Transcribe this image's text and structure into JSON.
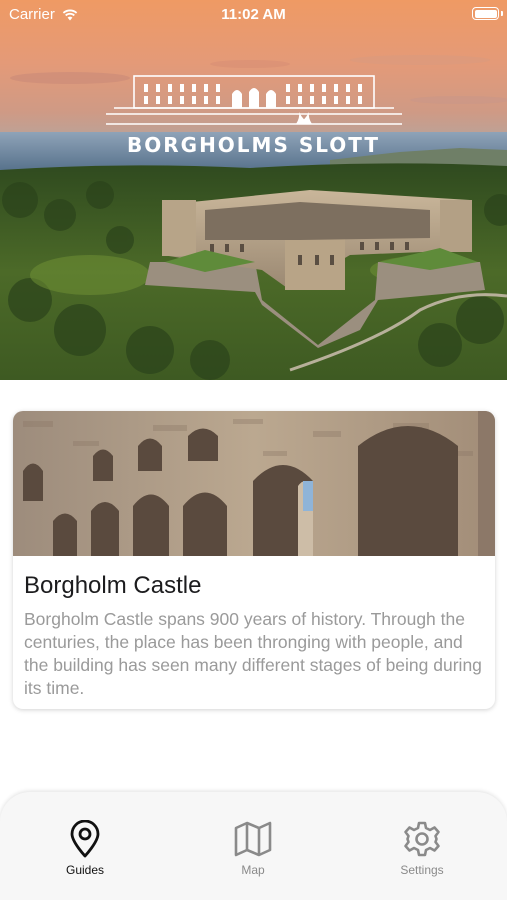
{
  "status_bar": {
    "carrier": "Carrier",
    "time": "11:02 AM",
    "battery_level": 1.0
  },
  "hero": {
    "brand_title": "BORGHOLMS SLOTT",
    "logo_icon": "castle-outline-logo"
  },
  "card": {
    "title": "Borgholm Castle",
    "description": "Borgholm Castle spans 900 years of history. Through the centuries, the place has been thronging with people, and the building has seen many different stages of being during its time."
  },
  "tabs": [
    {
      "label": "Guides",
      "icon": "map-pin-icon",
      "active": true
    },
    {
      "label": "Map",
      "icon": "map-icon",
      "active": false
    },
    {
      "label": "Settings",
      "icon": "gear-icon",
      "active": false
    }
  ],
  "colors": {
    "tab_active": "#111111",
    "tab_inactive": "#8a8a8a",
    "description_text": "#9a9a9a"
  }
}
